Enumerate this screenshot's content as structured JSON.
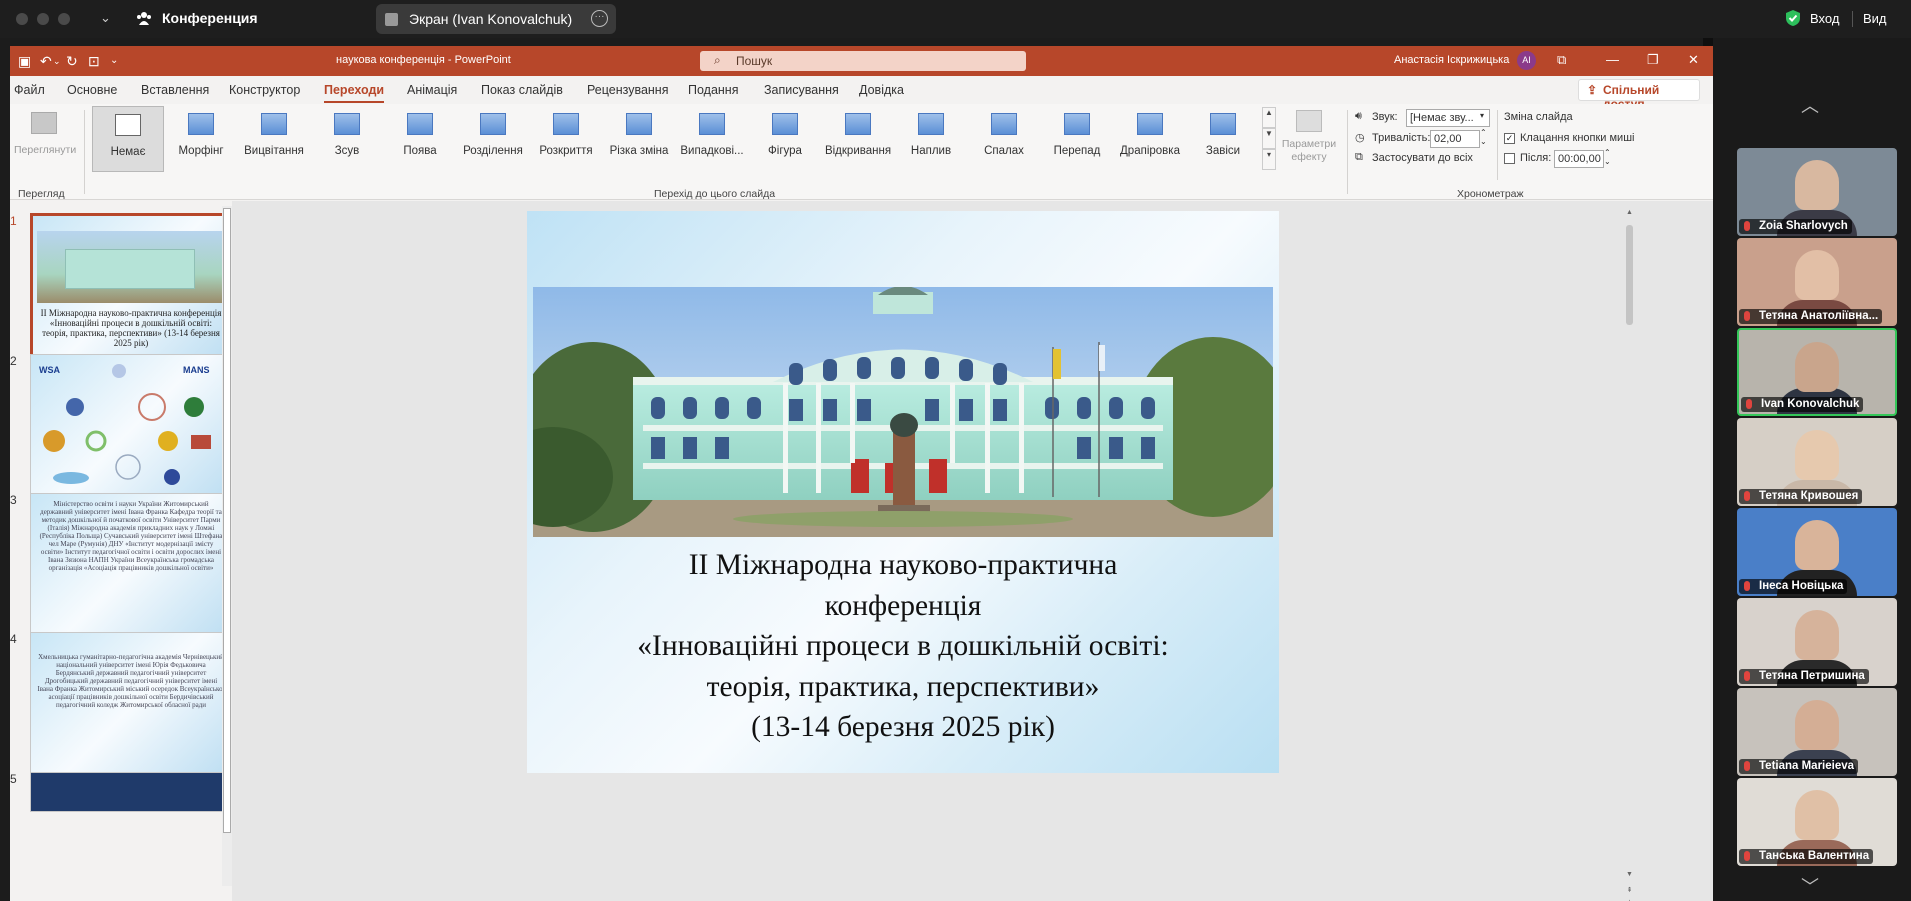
{
  "zoom_bar": {
    "meeting_title": "Конференция",
    "share_label": "Экран (Ivan Konovalchuk)",
    "login_label": "Вход",
    "view_label": "Вид"
  },
  "ppt": {
    "doc_title": "наукова конференція  -  PowerPoint",
    "search_placeholder": "Пошук",
    "user_name": "Анастасія Іскрижицька",
    "user_initials": "АІ",
    "accent": "#b7472a",
    "menu": [
      "Файл",
      "Основне",
      "Вставлення",
      "Конструктор",
      "Переходи",
      "Анімація",
      "Показ слайдів",
      "Рецензування",
      "Подання",
      "Записування",
      "Довідка"
    ],
    "active_menu": "Переходи",
    "share_button": "Спільний доступ",
    "ribbon": {
      "preview_label": "Переглянути",
      "preview_group": "Перегляд",
      "transitions": [
        "Немає",
        "Морфінг",
        "Вицвітання",
        "Зсув",
        "Поява",
        "Розділення",
        "Розкриття",
        "Різка зміна",
        "Випадкові...",
        "Фігура",
        "Відкривання",
        "Наплив",
        "Спалах",
        "Перепад",
        "Драпіровка",
        "Завіси"
      ],
      "transitions_group": "Перехід до цього слайда",
      "effects_label": "Параметри ефекту",
      "sound_label": "Звук:",
      "sound_value": "[Немає зву...",
      "duration_label": "Тривалість:",
      "duration_value": "02,00",
      "apply_all_label": "Застосувати до всіх",
      "advance_label": "Зміна слайда",
      "on_click_label": "Клацання кнопки миші",
      "after_label": "Після:",
      "after_value": "00:00,00",
      "timing_group": "Хронометраж"
    },
    "thumbnails": {
      "numbers": [
        "1",
        "2",
        "3",
        "4",
        "5"
      ],
      "slide1_text": "ІІ Міжнародна науково-практична конференція «Інноваційні процеси в дошкільній освіті: теорія, практика, перспективи» (13-14 березня 2025 рік)",
      "slide2_logos": [
        "WSA",
        "MANS"
      ],
      "slide3_text": "Міністерство освіти і науки України Житомирський державний університет імені Івана Франка Кафедра теорії та методик дошкільної й початкової освіти Університет Парми (Італія) Міжнародна академія прикладних наук у Ломжі (Республіка Польща) Сучавський університет імені Штефана чел Маре (Румунія) ДНУ «Інститут модернізації змісту освіти» Інститут педагогічної освіти і освіти дорослих імені Івана Зязюна НАПН України Всеукраїнська громадська організація «Асоціація працівників дошкільної освіти»",
      "slide4_text": "Хмельницька гуманітарно-педагогічна академія Чернівецький національний університет імені Юрія Федьковича Бердянський державний педагогічний університет Дрогобицький державний педагогічний університет імені Івана Франка Житомирський міський осередок Всеукраїнської асоціації працівників дошкільної освіти Бердичівський педагогічний коледж Житомирської обласної ради"
    },
    "slide": {
      "title": [
        "ІІ Міжнародна науково-практична",
        "конференція",
        "«Інноваційні процеси в дошкільній освіті:",
        "теорія, практика, перспективи»",
        "(13-14 березня 2025 рік)"
      ]
    }
  },
  "participants": [
    {
      "name": "Zoia Sharlovych",
      "bg": "#7d8a96",
      "skin": "#d8b8a0",
      "shirt": "#3b3b46"
    },
    {
      "name": "Тетяна Анатоліївна...",
      "bg": "#c9a08c",
      "skin": "#e2bfa6",
      "shirt": "#7a4a42"
    },
    {
      "name": "Ivan Konovalchuk",
      "bg": "#b8b4ac",
      "skin": "#c9a58c",
      "shirt": "#2e3442"
    },
    {
      "name": "Тетяна Кривошея",
      "bg": "#d6cfc6",
      "skin": "#e6c9ae",
      "shirt": "#c9b8a8"
    },
    {
      "name": "Інеса Новіцька",
      "bg": "#4a7fc8",
      "skin": "#d9b49a",
      "shirt": "#222"
    },
    {
      "name": "Тетяна Петришина",
      "bg": "#d8d2cc",
      "skin": "#d6b39b",
      "shirt": "#2a2a2a"
    },
    {
      "name": "Tetiana Marieieva",
      "bg": "#c7c2bc",
      "skin": "#d4ae95",
      "shirt": "#3b4150"
    },
    {
      "name": "Танська Валентина",
      "bg": "#e0dcd6",
      "skin": "#e0c0a6",
      "shirt": "#9a6a5a"
    }
  ]
}
